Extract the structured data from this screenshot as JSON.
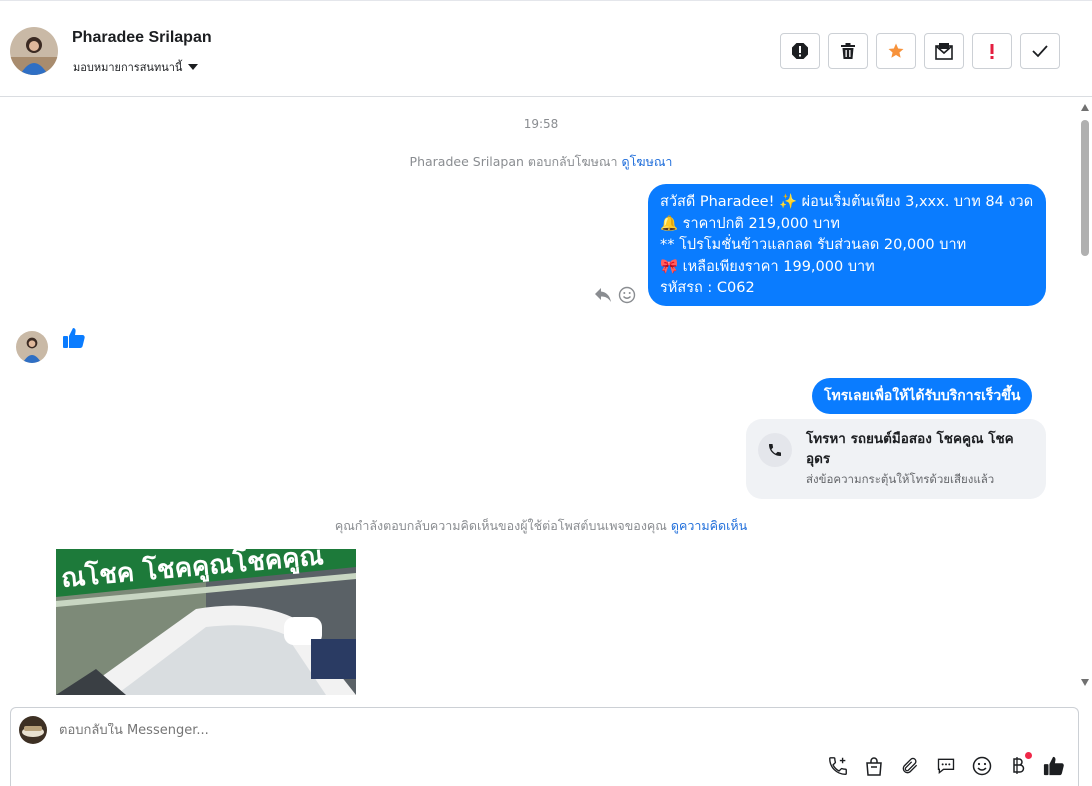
{
  "header": {
    "name": "Pharadee Srilapan",
    "assign_label": "มอบหมายการสนทนานี้",
    "actions": [
      {
        "id": "spam",
        "icon": "report-icon"
      },
      {
        "id": "delete",
        "icon": "trash-icon"
      },
      {
        "id": "star",
        "icon": "star-icon",
        "color": "#f7923b"
      },
      {
        "id": "mark-unread",
        "icon": "envelope-icon"
      },
      {
        "id": "important",
        "icon": "exclamation-icon",
        "color": "#e41e3f"
      },
      {
        "id": "done",
        "icon": "check-icon"
      }
    ]
  },
  "thread": {
    "timestamp": "19:58",
    "ad_reply": {
      "text": "Pharadee Srilapan ตอบกลับโฆษณา ",
      "link": "ดูโฆษณา"
    },
    "outgoing_message": {
      "lines": [
        "สวัสดี Pharadee! ✨  ผ่อนเริ่มต้นเพียง 3,xxx. บาท 84 งวด",
        "🔔 ราคาปกติ 219,000 บาท",
        "** โปรโมชั่นข้าวแลกลด รับส่วนลด 20,000 บาท",
        "🎀  เหลือเพียงราคา 199,000 บาท",
        " รหัสรถ : C062"
      ]
    },
    "call_prompt": {
      "text": "โทรเลยเพื่อให้ได้รับบริการเร็วขึ้น"
    },
    "call_card": {
      "title": "โทรหา รถยนต์มือสอง โชคคูณ โชค อุดร",
      "subtitle": "ส่งข้อความกระตุ้นให้โทรด้วยเสียงแล้ว"
    },
    "comment_reply": {
      "text": "คุณกำลังตอบกลับความคิดเห็นของผู้ใช้ต่อโพสต์บนเพจของคุณ ",
      "link": "ดูความคิดเห็น"
    },
    "photo_banner_text": "ณโชค โชคคูณโชคคูณ"
  },
  "composer": {
    "placeholder": "ตอบกลับใน Messenger...",
    "tools": [
      "phone-add-icon",
      "bag-icon",
      "paperclip-icon",
      "message-icon",
      "emoji-icon",
      "baht-icon",
      "thumbs-up-icon"
    ]
  },
  "colors": {
    "accent": "#0a7cff",
    "link": "#216fdb",
    "badge": "#f02849"
  }
}
